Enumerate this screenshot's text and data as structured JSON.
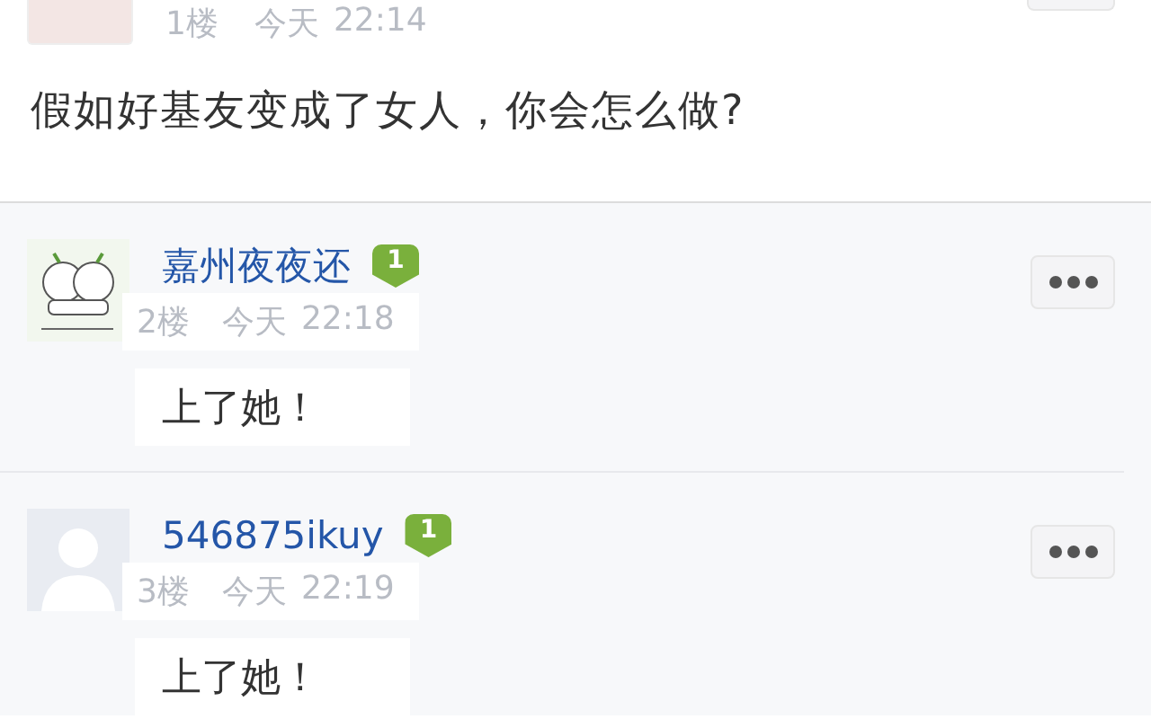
{
  "post": {
    "floor": "1楼",
    "day": "今天",
    "time": "22:14",
    "title": "假如好基友变成了女人，你会怎么做?"
  },
  "replies": [
    {
      "kind": "cartoon",
      "name": "嘉州夜夜还",
      "level": "1",
      "floor": "2楼",
      "day": "今天",
      "time": "22:18",
      "content": "上了她！"
    },
    {
      "kind": "default",
      "name": "546875ikuy",
      "level": "1",
      "floor": "3楼",
      "day": "今天",
      "time": "22:19",
      "content": "上了她！"
    }
  ]
}
